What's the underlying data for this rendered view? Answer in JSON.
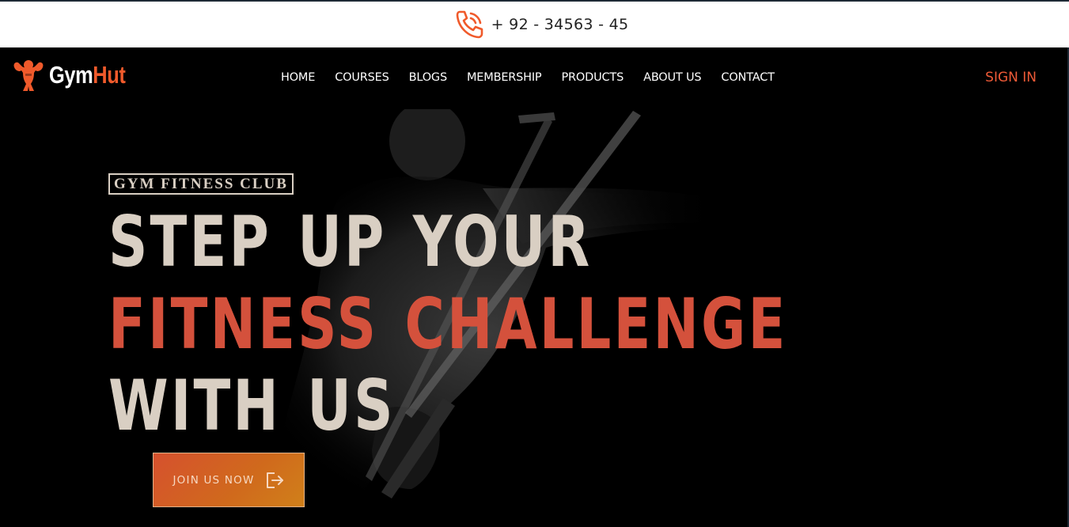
{
  "topbar": {
    "phone_icon": "phone-call-icon",
    "phone_number": "+ 92 - 34563 - 45"
  },
  "brand": {
    "icon": "muscle-man-icon",
    "name_part1": "Gym",
    "name_part2": "Hut",
    "accent_color": "#f05a2b"
  },
  "nav": {
    "items": [
      "HOME",
      "COURSES",
      "BLOGS",
      "MEMBERSHIP",
      "PRODUCTS",
      "ABOUT US",
      "CONTACT"
    ],
    "signin": "SIGN IN"
  },
  "hero": {
    "badge": "GYM FITNESS CLUB",
    "line1": "STEP UP YOUR",
    "line2": "FITNESS CHALLENGE",
    "line3": "WITH US",
    "cta_label": "JOIN US NOW",
    "cta_icon": "sign-out-arrow-icon",
    "headline_color": "#d9cfc3",
    "highlight_color": "#d4513c"
  }
}
